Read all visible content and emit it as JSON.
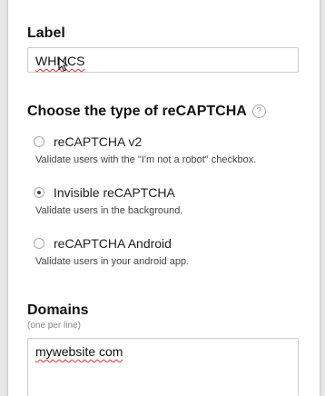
{
  "label_section": {
    "title": "Label",
    "input_value": "WHMCS"
  },
  "type_section": {
    "title": "Choose the type of reCAPTCHA",
    "help_glyph": "?",
    "options": [
      {
        "label": "reCAPTCHA v2",
        "description": "Validate users with the \"I'm not a robot\" checkbox.",
        "selected": false
      },
      {
        "label": "Invisible reCAPTCHA",
        "description": "Validate users in the background.",
        "selected": true
      },
      {
        "label": "reCAPTCHA Android",
        "description": "Validate users in your android app.",
        "selected": false
      }
    ]
  },
  "domains_section": {
    "title": "Domains",
    "hint": "(one per line)",
    "textarea_value": "mywebsite com"
  },
  "colors": {
    "spellcheck": "#d33",
    "card_background": "#ffffff"
  },
  "icons": {
    "help": "help-icon",
    "cursor": "mouse-pointer-icon"
  }
}
